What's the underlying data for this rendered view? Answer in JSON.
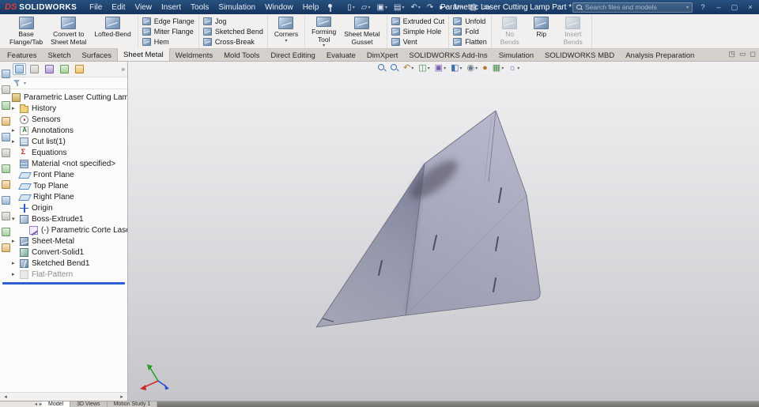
{
  "titlebar": {
    "logo_mark": "DS",
    "logo_text": "SOLIDWORKS",
    "menus": [
      "File",
      "Edit",
      "View",
      "Insert",
      "Tools",
      "Simulation",
      "Window",
      "Help"
    ],
    "document_title": "Parametric Laser Cutting Lamp Part *",
    "search_placeholder": "Search files and models",
    "window_buttons": {
      "help": "?",
      "minimize": "–",
      "maximize": "▢",
      "close": "×"
    }
  },
  "quick_toolbar": [
    {
      "name": "new-document-icon",
      "glyph": "▯",
      "caret": true
    },
    {
      "name": "open-icon",
      "glyph": "▱",
      "caret": true
    },
    {
      "name": "save-icon",
      "glyph": "▣",
      "caret": true
    },
    {
      "name": "print-icon",
      "glyph": "▤",
      "caret": true
    },
    {
      "name": "undo-icon",
      "glyph": "↶",
      "caret": true
    },
    {
      "name": "redo-icon",
      "glyph": "↷",
      "caret": false
    },
    {
      "name": "select-icon",
      "glyph": "▸",
      "caret": true
    },
    {
      "name": "rebuild-icon",
      "glyph": "↻",
      "caret": true
    },
    {
      "name": "file-properties-icon",
      "glyph": "▥",
      "caret": false
    },
    {
      "name": "options-icon",
      "glyph": "≡",
      "caret": true
    }
  ],
  "ribbon": {
    "groups": [
      {
        "type": "big",
        "items": [
          {
            "label": "Base\nFlange/Tab"
          },
          {
            "label": "Convert to\nSheet Metal"
          },
          {
            "label": "Lofted-Bend"
          }
        ]
      },
      {
        "type": "stack",
        "items": [
          {
            "label": "Edge Flange"
          },
          {
            "label": "Miter Flange"
          },
          {
            "label": "Hem"
          }
        ]
      },
      {
        "type": "stack",
        "items": [
          {
            "label": "Jog"
          },
          {
            "label": "Sketched Bend"
          },
          {
            "label": "Cross-Break"
          }
        ]
      },
      {
        "type": "big",
        "items": [
          {
            "label": "Corners",
            "caret": true
          }
        ]
      },
      {
        "type": "big",
        "items": [
          {
            "label": "Forming\nTool",
            "caret": true
          },
          {
            "label": "Sheet Metal\nGusset"
          }
        ]
      },
      {
        "type": "stack",
        "items": [
          {
            "label": "Extruded Cut"
          },
          {
            "label": "Simple Hole"
          },
          {
            "label": "Vent"
          }
        ]
      },
      {
        "type": "stack",
        "items": [
          {
            "label": "Unfold"
          },
          {
            "label": "Fold"
          },
          {
            "label": "Flatten"
          }
        ]
      },
      {
        "type": "big",
        "items": [
          {
            "label": "No\nBends",
            "disabled": true
          },
          {
            "label": "Rip"
          },
          {
            "label": "Insert\nBends",
            "disabled": true
          }
        ]
      }
    ]
  },
  "command_tabs": {
    "active_index": 3,
    "items": [
      "Features",
      "Sketch",
      "Surfaces",
      "Sheet Metal",
      "Weldments",
      "Mold Tools",
      "Direct Editing",
      "Evaluate",
      "DimXpert",
      "SOLIDWORKS Add-Ins",
      "Simulation",
      "SOLIDWORKS MBD",
      "Analysis Preparation"
    ]
  },
  "pane_controls": [
    {
      "name": "pane-layout-icon",
      "glyph": "◳"
    },
    {
      "name": "pane-minimize-icon",
      "glyph": "▭"
    },
    {
      "name": "pane-expand-icon",
      "glyph": "◻"
    }
  ],
  "view_toolbar": [
    {
      "name": "zoom-fit-icon",
      "glyph": "lens",
      "caret": false
    },
    {
      "name": "zoom-area-icon",
      "glyph": "lens",
      "caret": false
    },
    {
      "name": "previous-view-icon",
      "glyph": "↶",
      "caret": true
    },
    {
      "name": "section-view-icon",
      "glyph": "◫",
      "caret": true
    },
    {
      "name": "view-orientation-icon",
      "glyph": "▣",
      "caret": true
    },
    {
      "name": "display-style-icon",
      "glyph": "◧",
      "caret": true
    },
    {
      "name": "hide-show-items-icon",
      "glyph": "◉",
      "caret": true
    },
    {
      "name": "edit-appearance-icon",
      "glyph": "●",
      "caret": false
    },
    {
      "name": "apply-scene-icon",
      "glyph": "▦",
      "caret": true
    },
    {
      "name": "view-settings-icon",
      "glyph": "☼",
      "caret": true
    }
  ],
  "feature_panel": {
    "tabs": [
      {
        "name": "featuremanager-tab-icon",
        "tint": "blue",
        "active": true
      },
      {
        "name": "propertymanager-tab-icon",
        "tint": "gray",
        "active": false
      },
      {
        "name": "configurationmanager-tab-icon",
        "tint": "purple",
        "active": false
      },
      {
        "name": "dimxpertmanager-tab-icon",
        "tint": "green",
        "active": false
      },
      {
        "name": "displaymanager-tab-icon",
        "tint": "orange",
        "active": false
      }
    ],
    "overflow_glyph": "»",
    "tree": [
      {
        "label": "Parametric Laser Cutting Lamp Part  (D",
        "icon": "part",
        "indent": 0,
        "expander": null
      },
      {
        "label": "History",
        "icon": "history",
        "indent": 1,
        "expander": "closed"
      },
      {
        "label": "Sensors",
        "icon": "sensors",
        "indent": 1,
        "expander": null
      },
      {
        "label": "Annotations",
        "icon": "annotations",
        "indent": 1,
        "expander": "closed"
      },
      {
        "label": "Cut list(1)",
        "icon": "cutlist",
        "indent": 1,
        "expander": "closed"
      },
      {
        "label": "Equations",
        "icon": "equations",
        "indent": 1,
        "expander": null
      },
      {
        "label": "Material <not specified>",
        "icon": "material",
        "indent": 1,
        "expander": null
      },
      {
        "label": "Front Plane",
        "icon": "plane",
        "indent": 1,
        "expander": null
      },
      {
        "label": "Top Plane",
        "icon": "plane",
        "indent": 1,
        "expander": null
      },
      {
        "label": "Right Plane",
        "icon": "plane",
        "indent": 1,
        "expander": null
      },
      {
        "label": "Origin",
        "icon": "origin",
        "indent": 1,
        "expander": null
      },
      {
        "label": "Boss-Extrude1",
        "icon": "extrude",
        "indent": 1,
        "expander": "open"
      },
      {
        "label": "(-) Parametric Corte Laser",
        "icon": "sketch",
        "indent": 2,
        "expander": null
      },
      {
        "label": "Sheet-Metal",
        "icon": "sheetmetal",
        "indent": 1,
        "expander": "closed"
      },
      {
        "label": "Convert-Solid1",
        "icon": "convert",
        "indent": 1,
        "expander": null
      },
      {
        "label": "Sketched Bend1",
        "icon": "bend",
        "indent": 1,
        "expander": "closed"
      },
      {
        "label": "Flat-Pattern",
        "icon": "flatpattern",
        "indent": 1,
        "expander": "closed",
        "dim": true
      }
    ],
    "scroll": {
      "left": "◂",
      "right": "▸"
    }
  },
  "side_toolbar": [
    {
      "name": "side-tool-icon"
    },
    {
      "name": "side-tool-icon"
    },
    {
      "name": "side-tool-icon"
    },
    {
      "name": "side-tool-icon"
    },
    {
      "name": "side-tool-icon"
    },
    {
      "name": "side-tool-icon"
    },
    {
      "name": "side-tool-icon"
    },
    {
      "name": "side-tool-icon"
    },
    {
      "name": "side-tool-icon"
    },
    {
      "name": "side-tool-icon"
    },
    {
      "name": "side-tool-icon"
    },
    {
      "name": "side-tool-icon"
    }
  ],
  "bottom_bar": {
    "nav_left": "◂",
    "nav_right": "▸",
    "active_index": 0,
    "tabs": [
      "Model",
      "3D Views",
      "Motion Study 1"
    ]
  }
}
